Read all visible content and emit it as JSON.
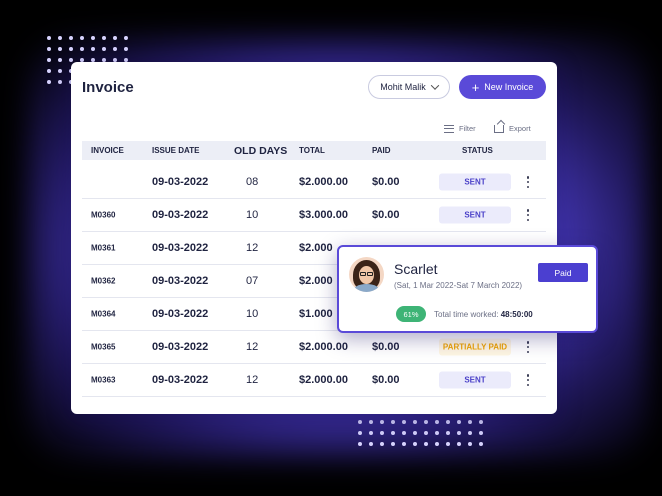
{
  "header": {
    "title": "Invoice",
    "user": "Mohit Malik",
    "new_button": "New Invoice"
  },
  "toolbar": {
    "filter": "Filter",
    "export": "Export"
  },
  "table": {
    "columns": {
      "invoice": "INVOICE",
      "issue_date": "ISSUE DATE",
      "old_days": "OLD DAYS",
      "total": "TOTAL",
      "paid": "PAID",
      "status": "STATUS"
    },
    "rows": [
      {
        "invoice": "",
        "issue_date": "09-03-2022",
        "old_days": "08",
        "total": "$2.000.00",
        "paid": "$0.00",
        "status": "SENT"
      },
      {
        "invoice": "M0360",
        "issue_date": "09-03-2022",
        "old_days": "10",
        "total": "$3.000.00",
        "paid": "$0.00",
        "status": "SENT"
      },
      {
        "invoice": "M0361",
        "issue_date": "09-03-2022",
        "old_days": "12",
        "total": "$2.000",
        "paid": "",
        "status": ""
      },
      {
        "invoice": "M0362",
        "issue_date": "09-03-2022",
        "old_days": "07",
        "total": "$2.000",
        "paid": "",
        "status": ""
      },
      {
        "invoice": "M0364",
        "issue_date": "09-03-2022",
        "old_days": "10",
        "total": "$1.000",
        "paid": "",
        "status": ""
      },
      {
        "invoice": "M0365",
        "issue_date": "09-03-2022",
        "old_days": "12",
        "total": "$2.000.00",
        "paid": "$0.00",
        "status": "PARTIALLY PAID"
      },
      {
        "invoice": "M0363",
        "issue_date": "09-03-2022",
        "old_days": "12",
        "total": "$2.000.00",
        "paid": "$0.00",
        "status": "SENT"
      }
    ]
  },
  "popup": {
    "name": "Scarlet",
    "range": "(Sat, 1 Mar 2022-Sat 7 March 2022)",
    "status_button": "Paid",
    "progress": "61%",
    "time_label": "Total time worked:",
    "time_value": "48:50:00"
  },
  "colors": {
    "accent": "#5a4ad8",
    "sent_text": "#4a40c8",
    "partial_text": "#f0a500",
    "progress": "#3eb476"
  }
}
